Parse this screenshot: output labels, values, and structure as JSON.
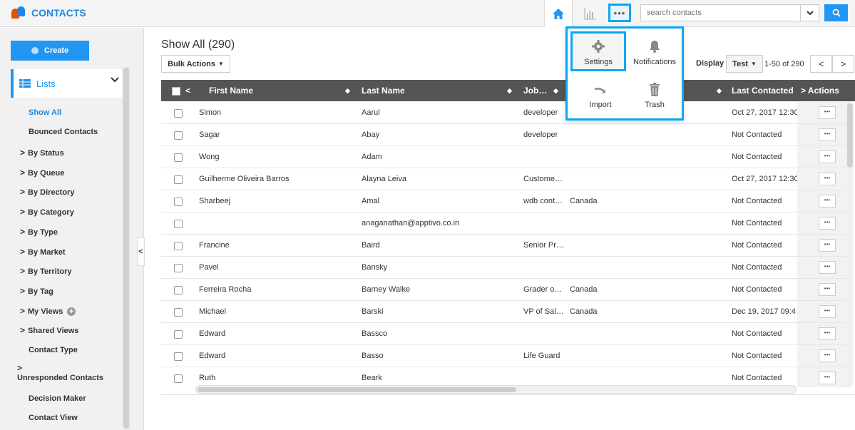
{
  "app": {
    "title": "CONTACTS"
  },
  "search": {
    "placeholder": "search contacts"
  },
  "sidebar": {
    "create_label": "Create",
    "lists_label": "Lists",
    "items": [
      {
        "label": "Show All",
        "active": true,
        "caret": false
      },
      {
        "label": "Bounced Contacts",
        "caret": false
      },
      {
        "label": "By Status",
        "caret": true
      },
      {
        "label": "By Queue",
        "caret": true
      },
      {
        "label": "By Directory",
        "caret": true
      },
      {
        "label": "By Category",
        "caret": true
      },
      {
        "label": "By Type",
        "caret": true
      },
      {
        "label": "By Market",
        "caret": true
      },
      {
        "label": "By Territory",
        "caret": true
      },
      {
        "label": "By Tag",
        "caret": true
      },
      {
        "label": "My Views",
        "caret": true,
        "add": true
      },
      {
        "label": "Shared Views",
        "caret": true
      },
      {
        "label": "Contact Type",
        "caret": false
      },
      {
        "label": "Unresponded Contacts",
        "caret": true,
        "wrap": true
      },
      {
        "label": "Decision Maker",
        "caret": false
      },
      {
        "label": "Contact View",
        "caret": false
      }
    ]
  },
  "main": {
    "title": "Show All (290)",
    "bulk_label": "Bulk Actions",
    "display_label": "Display",
    "display_value": "Test",
    "range_text": "1-50 of 290"
  },
  "columns": {
    "first_name": "First Name",
    "last_name": "Last Name",
    "job": "Job…",
    "last_contacted": "Last Contacted",
    "actions": "Actions"
  },
  "rows": [
    {
      "first": "Simon",
      "last": "Aarul",
      "job": "developer",
      "country": "",
      "contacted": "Oct 27, 2017 12:30"
    },
    {
      "first": "Sagar",
      "last": "Abay",
      "job": "developer",
      "country": "",
      "contacted": "Not Contacted"
    },
    {
      "first": "Wong",
      "last": "Adam",
      "job": "",
      "country": "",
      "contacted": "Not Contacted"
    },
    {
      "first": "Guilherme Oliveira Barros",
      "last": "Alayna Leiva",
      "job": "Custome…",
      "country": "",
      "contacted": "Oct 27, 2017 12:30"
    },
    {
      "first": "Sharbeej",
      "last": "Amal",
      "job": "wdb cont…",
      "country": "Canada",
      "contacted": "Not Contacted"
    },
    {
      "first": "",
      "last": "anaganathan@apptivo.co.in",
      "job": "",
      "country": "",
      "contacted": "Not Contacted"
    },
    {
      "first": "Francine",
      "last": "Baird",
      "job": "Senior Pr…",
      "country": "",
      "contacted": "Not Contacted"
    },
    {
      "first": "Pavel",
      "last": "Bansky",
      "job": "",
      "country": "",
      "contacted": "Not Contacted"
    },
    {
      "first": "Ferreira Rocha",
      "last": "Barney Walke",
      "job": "Grader o…",
      "country": "Canada",
      "contacted": "Not Contacted"
    },
    {
      "first": "Michael",
      "last": "Barski",
      "job": "VP of Sal…",
      "country": "Canada",
      "contacted": "Dec 19, 2017 09:4"
    },
    {
      "first": "Edward",
      "last": "Bassco",
      "job": "",
      "country": "",
      "contacted": "Not Contacted"
    },
    {
      "first": "Edward",
      "last": "Basso",
      "job": "Life Guard",
      "country": "",
      "contacted": "Not Contacted"
    },
    {
      "first": "Ruth",
      "last": "Beark",
      "job": "",
      "country": "",
      "contacted": "Not Contacted"
    }
  ],
  "popup": {
    "settings": "Settings",
    "notifications": "Notifications",
    "import": "Import",
    "trash": "Trash"
  },
  "colors": {
    "accent": "#2196f3",
    "highlight": "#03a9f4",
    "header_bg": "#555555"
  }
}
